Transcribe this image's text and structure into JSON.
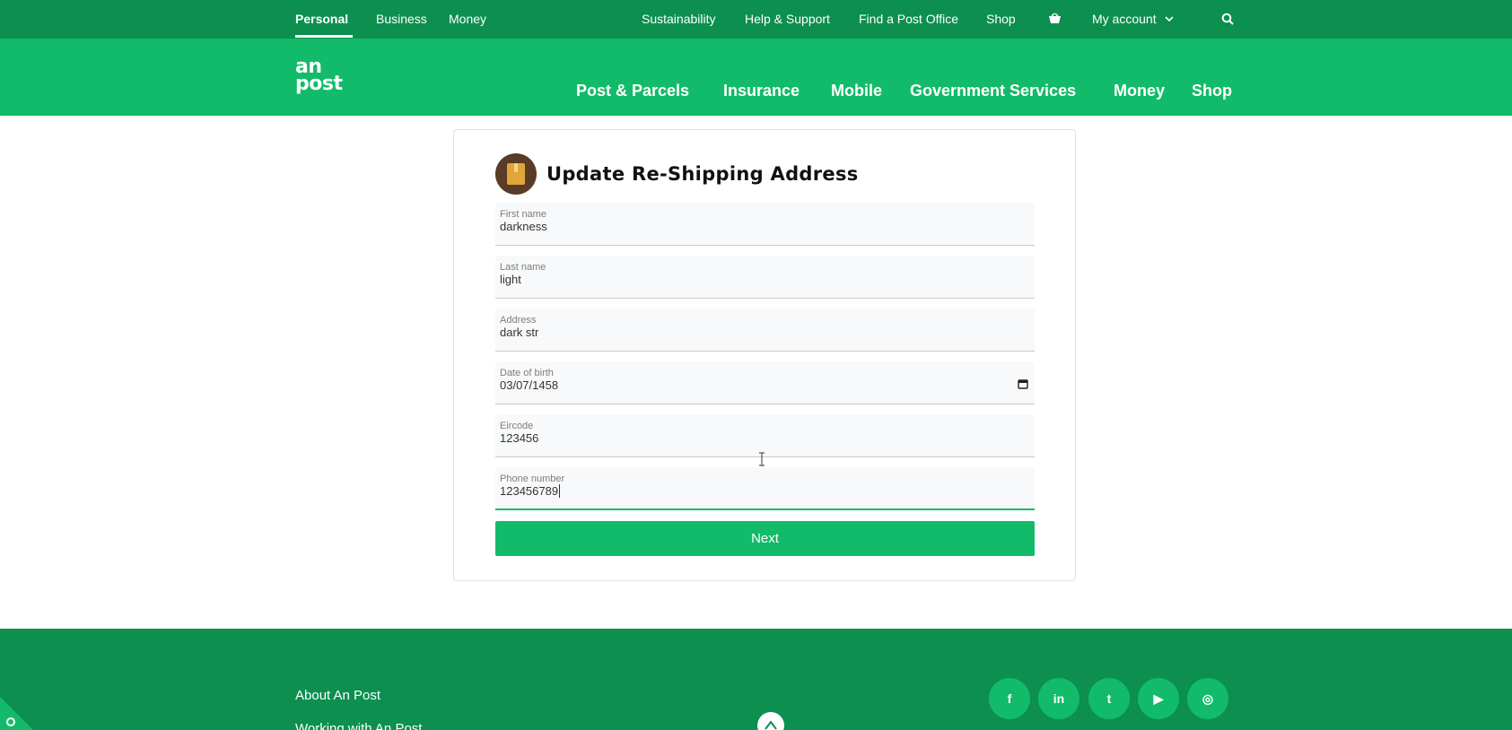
{
  "topbar": {
    "segments": [
      "Personal",
      "Business",
      "Money"
    ],
    "links": [
      "Sustainability",
      "Help & Support",
      "Find a Post Office",
      "Shop"
    ],
    "account_label": "My account"
  },
  "header": {
    "logo_line1": "an",
    "logo_line2": "post",
    "nav": [
      "Post & Parcels",
      "Insurance",
      "Mobile",
      "Government Services",
      "Money",
      "Shop"
    ]
  },
  "form": {
    "title": "Update Re-Shipping Address",
    "fields": [
      {
        "label": "First name",
        "value": "darkness"
      },
      {
        "label": "Last name",
        "value": "light"
      },
      {
        "label": "Address",
        "value": "dark str"
      },
      {
        "label": "Date of birth",
        "value": "03/07/1458"
      },
      {
        "label": "Eircode",
        "value": "123456"
      },
      {
        "label": "Phone number",
        "value": "123456789"
      }
    ],
    "next_label": "Next"
  },
  "footer": {
    "links": [
      "About An Post",
      "Working with An Post"
    ],
    "social": [
      {
        "icon": "facebook-icon",
        "glyph": "f"
      },
      {
        "icon": "linkedin-icon",
        "glyph": "in"
      },
      {
        "icon": "twitter-icon",
        "glyph": "t"
      },
      {
        "icon": "youtube-icon",
        "glyph": "▶"
      },
      {
        "icon": "instagram-icon",
        "glyph": "◎"
      }
    ]
  },
  "colors": {
    "topbar": "#0c8f4f",
    "brand_green": "#12bb6a",
    "footer": "#0c8f4f"
  }
}
